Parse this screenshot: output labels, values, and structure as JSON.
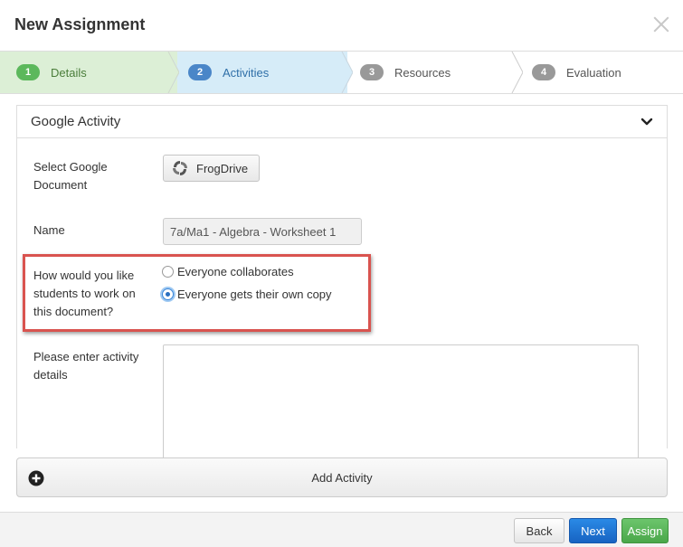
{
  "modal": {
    "title": "New Assignment"
  },
  "steps": [
    {
      "num": "1",
      "label": "Details",
      "state": "complete"
    },
    {
      "num": "2",
      "label": "Activities",
      "state": "active"
    },
    {
      "num": "3",
      "label": "Resources",
      "state": "inactive"
    },
    {
      "num": "4",
      "label": "Evaluation",
      "state": "inactive"
    }
  ],
  "activity": {
    "heading": "Google Activity",
    "select_doc_label_line1": "Select Google",
    "select_doc_label_line2": "Document",
    "frogdrive_label": "FrogDrive",
    "name_label": "Name",
    "name_value": "7a/Ma1 - Algebra - Worksheet 1",
    "work_label_line1": "How would you like",
    "work_label_line2": "students to work on",
    "work_label_line3": "this document?",
    "options": [
      {
        "label": "Everyone collaborates",
        "selected": false
      },
      {
        "label": "Everyone gets their own copy",
        "selected": true
      }
    ],
    "details_label_line1": "Please enter activity",
    "details_label_line2": "details",
    "details_value": ""
  },
  "add_activity_label": "Add Activity",
  "footer": {
    "back": "Back",
    "next": "Next",
    "assign": "Assign"
  },
  "colors": {
    "highlight": "#d9534f",
    "next": "#1d6fd0",
    "assign": "#5cb85c",
    "step_complete": "#dcefd6",
    "step_active": "#d6ecf8"
  }
}
